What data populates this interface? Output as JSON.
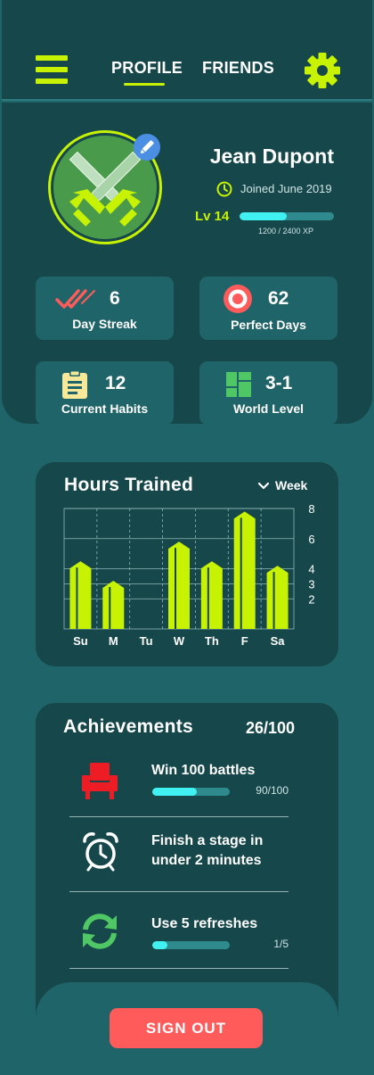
{
  "header": {
    "menu_icon": "hamburger-menu-icon",
    "tabs": [
      {
        "label": "PROFILE",
        "active": true
      },
      {
        "label": "FRIENDS",
        "active": false
      }
    ],
    "settings_icon": "gear-icon",
    "accent": "#c8f203"
  },
  "profile": {
    "avatar_icon": "crossed-swords-icon",
    "name": "Jean Dupont",
    "joined": "Joined June 2019",
    "level": "Lv 14",
    "xp_text": "1200 / 2400 XP",
    "xp_fraction": 0.5
  },
  "stats": [
    {
      "icon": "double-check-icon",
      "value": "6",
      "label": "Day Streak"
    },
    {
      "icon": "target-icon",
      "value": "62",
      "label": "Perfect Days"
    },
    {
      "icon": "clipboard-icon",
      "value": "12",
      "label": "Current Habits"
    },
    {
      "icon": "world-grid-icon",
      "value": "3-1",
      "label": "World Level"
    }
  ],
  "hours": {
    "title": "Hours Trained",
    "range": "Week"
  },
  "chart_data": {
    "type": "bar",
    "categories": [
      "Su",
      "M",
      "Tu",
      "W",
      "Th",
      "F",
      "Sa"
    ],
    "values": [
      4.5,
      3.2,
      0,
      5.8,
      4.5,
      7.8,
      4.2
    ],
    "y_ticks": [
      "2",
      "3",
      "4",
      "6",
      "8"
    ],
    "ylim": [
      0,
      8
    ],
    "grid": true,
    "bar_color": "#c8f203"
  },
  "achievements": {
    "title": "Achievements",
    "count": "26/100",
    "items": [
      {
        "icon": "armchair-icon",
        "name": "Win 100 battles",
        "progress": "90/100",
        "fraction": 0.57
      },
      {
        "icon": "alarm-clock-icon",
        "name": "Finish a stage in under 2 minutes",
        "progress": null
      },
      {
        "icon": "refresh-icon",
        "name": "Use 5 refreshes",
        "progress": "1/5",
        "fraction": 0.2
      }
    ]
  },
  "footer": {
    "sign_out_label": "SIGN OUT",
    "sign_out_color": "#ff5b5b"
  }
}
